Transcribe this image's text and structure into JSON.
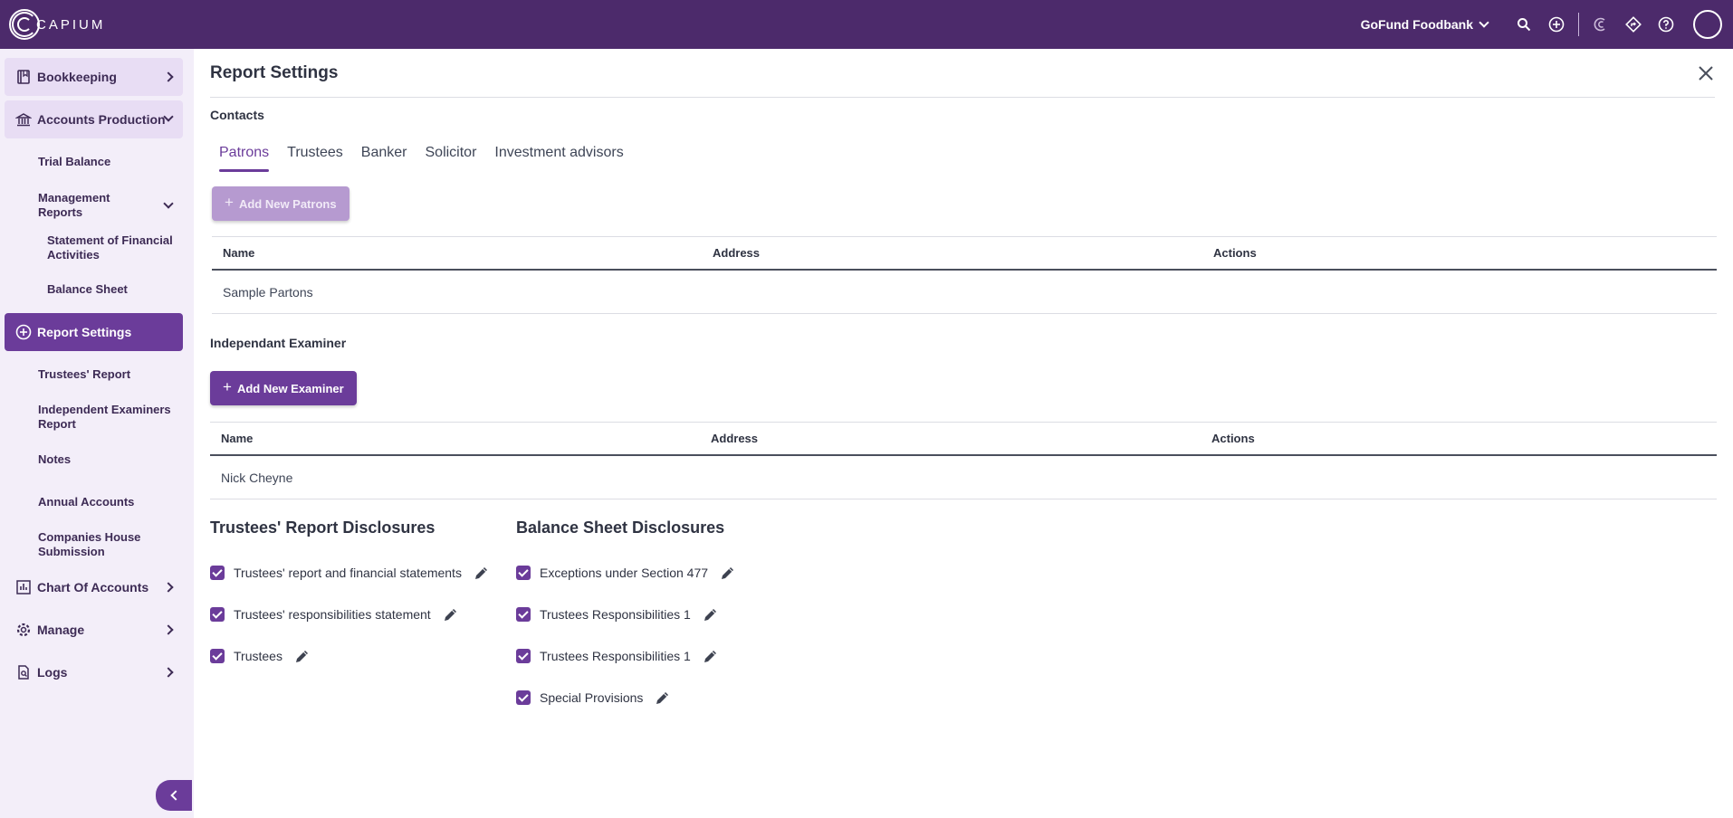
{
  "app": {
    "logo_text": "CAPIUM"
  },
  "topbar": {
    "org_name": "GoFund Foodbank"
  },
  "sidebar": {
    "bookkeeping": "Bookkeeping",
    "accounts_production": "Accounts Production",
    "trial_balance": "Trial Balance",
    "management_reports": "Management Reports",
    "statement_fin_activities": "Statement of Financial Activities",
    "balance_sheet": "Balance Sheet",
    "report_settings": "Report Settings",
    "trustees_report": "Trustees' Report",
    "independent_examiners_report": "Independent Examiners Report",
    "notes": "Notes",
    "annual_accounts": "Annual Accounts",
    "companies_house_submission": "Companies House Submission",
    "chart_of_accounts": "Chart Of Accounts",
    "manage": "Manage",
    "logs": "Logs"
  },
  "main": {
    "title": "Report Settings",
    "contacts_label": "Contacts",
    "tabs": [
      "Patrons",
      "Trustees",
      "Banker",
      "Solicitor",
      "Investment advisors"
    ],
    "add_patrons_label": "Add New Patrons",
    "table_headers": {
      "name": "Name",
      "address": "Address",
      "actions": "Actions"
    },
    "patrons_rows": [
      {
        "name": "Sample Partons",
        "address": "",
        "actions": ""
      }
    ],
    "examiner_label": "Independant Examiner",
    "add_examiner_label": "Add New Examiner",
    "examiner_rows": [
      {
        "name": "Nick Cheyne",
        "address": "",
        "actions": ""
      }
    ],
    "trustees_disclosures_title": "Trustees' Report Disclosures",
    "trustees_disclosures": [
      {
        "label": "Trustees' report and financial statements",
        "checked": true
      },
      {
        "label": "Trustees' responsibilities statement",
        "checked": true
      },
      {
        "label": "Trustees",
        "checked": true
      }
    ],
    "balance_disclosures_title": "Balance Sheet Disclosures",
    "balance_disclosures": [
      {
        "label": "Exceptions under Section 477",
        "checked": true
      },
      {
        "label": "Trustees Responsibilities 1",
        "checked": true
      },
      {
        "label": "Trustees Responsibilities 1",
        "checked": true
      },
      {
        "label": "Special Provisions",
        "checked": true
      }
    ]
  },
  "colors": {
    "topbar": "#4c2a6b",
    "accent": "#6b3c9a",
    "sidebar_bg": "#f3eef9"
  }
}
